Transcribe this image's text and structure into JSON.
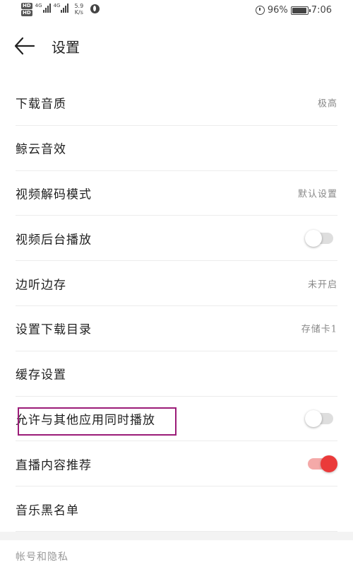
{
  "status_bar": {
    "hd_badges": [
      "HD",
      "HD"
    ],
    "network_labels": [
      "4G",
      "4G"
    ],
    "net_speed_value": "5.9",
    "net_speed_unit": "K/s",
    "battery_percent": "96%",
    "battery_level": 0.96,
    "time": "7:06"
  },
  "header": {
    "title": "设置"
  },
  "settings": [
    {
      "label": "下载音质",
      "value": "极高"
    },
    {
      "label": "鲸云音效"
    },
    {
      "label": "视频解码模式",
      "value": "默认设置"
    },
    {
      "label": "视频后台播放",
      "toggle": false
    },
    {
      "label": "边听边存",
      "value": "未开启"
    },
    {
      "label": "设置下载目录",
      "value": "存储卡1"
    },
    {
      "label": "缓存设置"
    },
    {
      "label": "允许与其他应用同时播放",
      "toggle": false
    },
    {
      "label": "直播内容推荐",
      "toggle": true
    },
    {
      "label": "音乐黑名单"
    }
  ],
  "section_header": "帐号和隐私",
  "colors": {
    "toggle_on_knob": "#ea3a3a",
    "toggle_on_track": "#f4a9a8",
    "toggle_off_track": "#dedede",
    "highlight_border": "#9b1c78"
  }
}
